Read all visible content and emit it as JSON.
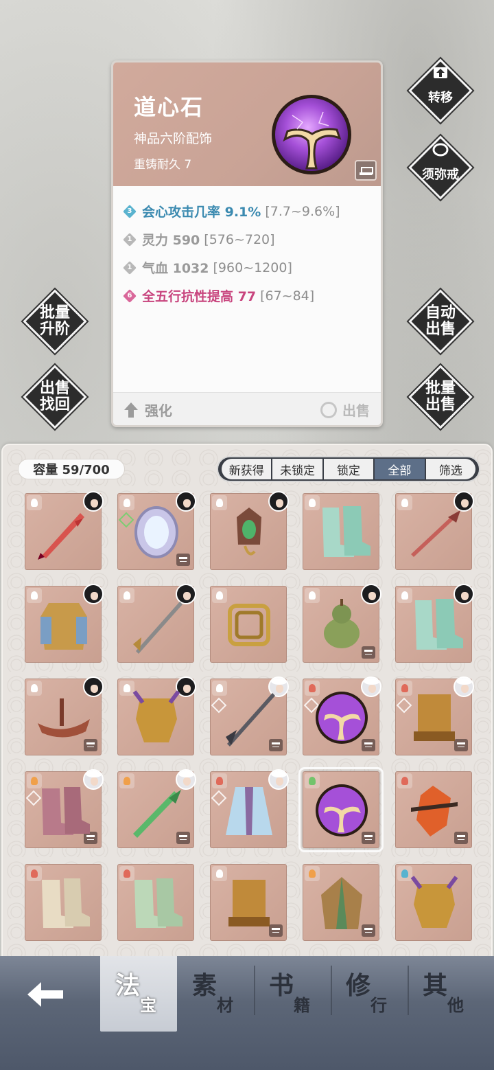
{
  "item": {
    "name": "道心石",
    "grade": "神品六阶配饰",
    "durability": "重铸耐久 7",
    "attributes": [
      {
        "level": "3",
        "color": "blue",
        "label": "会心攻击几率 9.1%",
        "range": "[7.7~9.6%]"
      },
      {
        "level": "1",
        "color": "gray",
        "label": "灵力 590",
        "range": "[576~720]"
      },
      {
        "level": "1",
        "color": "gray",
        "label": "气血 1032",
        "range": "[960~1200]"
      },
      {
        "level": "6",
        "color": "pink",
        "label": "全五行抗性提高 77",
        "range": "[67~84]"
      }
    ],
    "strengthen_label": "强化",
    "sell_label": "出售"
  },
  "side_buttons": {
    "transfer": "转移",
    "ring": "须弥戒",
    "batch_upgrade": "批量升阶",
    "sell_recover": "出售找回",
    "auto_sell": "自动出售",
    "batch_sell": "批量出售"
  },
  "inventory": {
    "capacity": "容量 59/700",
    "filters": [
      "新获得",
      "未锁定",
      "锁定",
      "全部",
      "筛选"
    ],
    "active_filter": "全部"
  },
  "nav": {
    "tabs": [
      {
        "big": "法",
        "small": "宝"
      },
      {
        "big": "素",
        "small": "材"
      },
      {
        "big": "书",
        "small": "籍"
      },
      {
        "big": "修",
        "small": "行"
      },
      {
        "big": "其",
        "small": "他"
      }
    ]
  },
  "colors": {
    "card_head": "#d1aa9c",
    "slot_bg": "#d8b2a4",
    "active_filter": "#5d6f88",
    "nav_bg": "#5c6677"
  }
}
